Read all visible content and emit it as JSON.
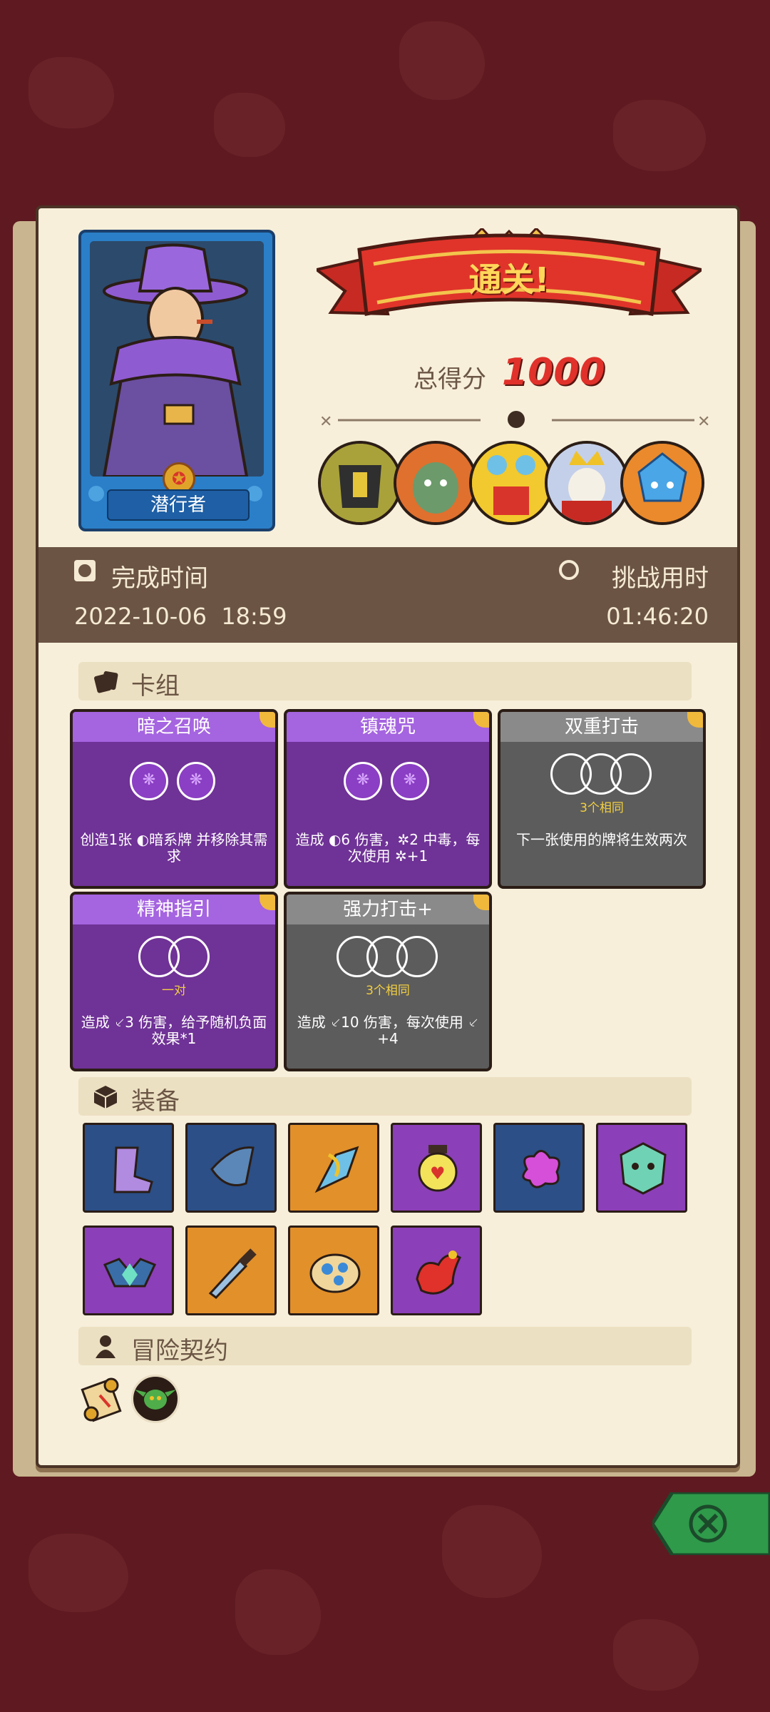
{
  "result": {
    "banner_text": "通关!",
    "score_label": "总得分",
    "score_value": "1000"
  },
  "hero": {
    "name": "潜行者",
    "icon": "wizard-hat-character-portrait"
  },
  "bosses": [
    {
      "name": "armored-knight-boss-icon"
    },
    {
      "name": "orc-boss-icon"
    },
    {
      "name": "jester-skull-boss-icon"
    },
    {
      "name": "bone-king-boss-icon"
    },
    {
      "name": "crystal-golem-boss-icon"
    }
  ],
  "stats": {
    "finish_time_label": "完成时间",
    "finish_time_value": "2022-10-06  18:59",
    "challenge_time_label": "挑战用时",
    "challenge_time_value": "01:46:20"
  },
  "deck": {
    "title": "卡组",
    "cards": [
      {
        "title": "暗之召唤",
        "style": "purple",
        "slots": "gems2",
        "combo": "",
        "desc": "创造1张 ◐暗系牌 并移除其需求"
      },
      {
        "title": "镇魂咒",
        "style": "purple",
        "slots": "gems2",
        "combo": "",
        "desc": "造成 ◐6 伤害，✲2 中毒，每次使用 ✲+1"
      },
      {
        "title": "双重打击",
        "style": "gray",
        "slots": "rings3",
        "combo": "3个相同",
        "desc": "下一张使用的牌将生效两次"
      },
      {
        "title": "精神指引",
        "style": "purple",
        "slots": "rings2",
        "combo": "一对",
        "desc": "造成 ⸔3 伤害，给予随机负面效果*1"
      },
      {
        "title": "强力打击+",
        "style": "gray",
        "slots": "rings3",
        "combo": "3个相同",
        "desc": "造成 ⸔10 伤害，每次使用 ⸔+4"
      }
    ]
  },
  "equipment": {
    "title": "装备",
    "items": [
      {
        "name": "crystal-boot-icon",
        "bg": "#2b4f86"
      },
      {
        "name": "hook-blade-icon",
        "bg": "#2b4f86"
      },
      {
        "name": "crystal-wing-icon",
        "bg": "#e2902a"
      },
      {
        "name": "heart-lantern-icon",
        "bg": "#8b3fb8"
      },
      {
        "name": "paint-splash-icon",
        "bg": "#2b4f86"
      },
      {
        "name": "demon-mask-icon",
        "bg": "#8b3fb8"
      },
      {
        "name": "bat-gem-icon",
        "bg": "#8b3fb8"
      },
      {
        "name": "serrated-sword-icon",
        "bg": "#e2902a"
      },
      {
        "name": "paint-palette-icon",
        "bg": "#e2902a"
      },
      {
        "name": "fire-potion-icon",
        "bg": "#8b3fb8"
      }
    ]
  },
  "contract": {
    "title": "冒险契约",
    "items": [
      "scroll-icon",
      "goblin-token-icon"
    ]
  },
  "colors": {
    "background": "#5e1a20",
    "panel": "#f7efda",
    "score_red": "#e0312a",
    "banner_red": "#d9342b",
    "close_green": "#2e9a4a"
  }
}
